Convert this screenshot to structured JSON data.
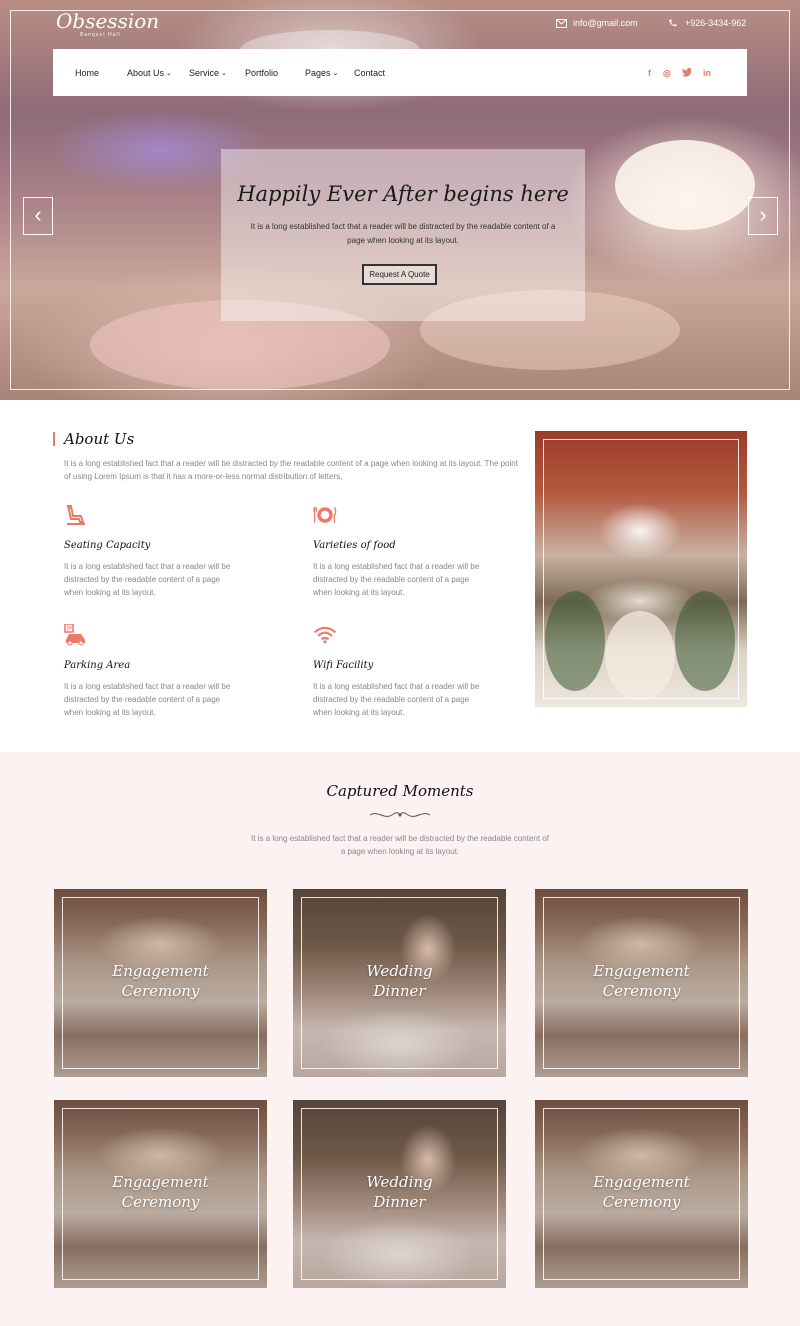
{
  "header": {
    "logo_text": "Obsession",
    "logo_subtext": "Banquet Hall",
    "email": "info@gmail.com",
    "phone": "+926-3434-962"
  },
  "nav": {
    "home": "Home",
    "about": "About Us",
    "service": "Service",
    "portfolio": "Portfolio",
    "pages": "Pages",
    "contact": "Contact"
  },
  "social": {
    "facebook": "f",
    "instagram": "◎",
    "twitter": "🐦",
    "linkedin": "in"
  },
  "hero": {
    "title": "Happily Ever After begins here",
    "text": "It is a long established fact that a reader will be distracted by the readable content of a page when looking at its layout.",
    "button": "Request A Quote",
    "prev_icon": "‹",
    "next_icon": "›"
  },
  "about": {
    "title": "About Us",
    "text": "It is a long established fact that a reader will be distracted by the readable content of a page when looking at its layout. The point of using Lorem Ipsum is that it has a more-or-less normal distribution of letters,",
    "features": [
      {
        "title": "Seating Capacity",
        "text": "It is a long established fact that a reader will be distracted by the readable content of a page when looking at its layout.",
        "icon": "seat-icon"
      },
      {
        "title": "Varieties of food",
        "text": "It is a long established fact that a reader will be distracted by the readable content of a page when looking at its layout.",
        "icon": "plate-icon"
      },
      {
        "title": "Parking Area",
        "text": "It is a long established fact that a reader will be distracted by the readable content of a page when looking at its layout.",
        "icon": "car-icon"
      },
      {
        "title": "Wifi Facility",
        "text": "It is a long established fact that a reader will be distracted by the readable content of a page when looking at its layout.",
        "icon": "wifi-icon"
      }
    ]
  },
  "gallery": {
    "title": "Captured Moments",
    "text": "It is a long established fact that a reader will be distracted by the readable content of a page when looking at its layout.",
    "cards": [
      {
        "line1": "Engagement",
        "line2": "Ceremony"
      },
      {
        "line1": "Wedding",
        "line2": "Dinner"
      },
      {
        "line1": "Engagement",
        "line2": "Ceremony"
      },
      {
        "line1": "Engagement",
        "line2": "Ceremony"
      },
      {
        "line1": "Wedding",
        "line2": "Dinner"
      },
      {
        "line1": "Engagement",
        "line2": "Ceremony"
      }
    ]
  },
  "colors": {
    "accent": "#e97a6a",
    "gallery_bg": "#fdf2f2"
  }
}
